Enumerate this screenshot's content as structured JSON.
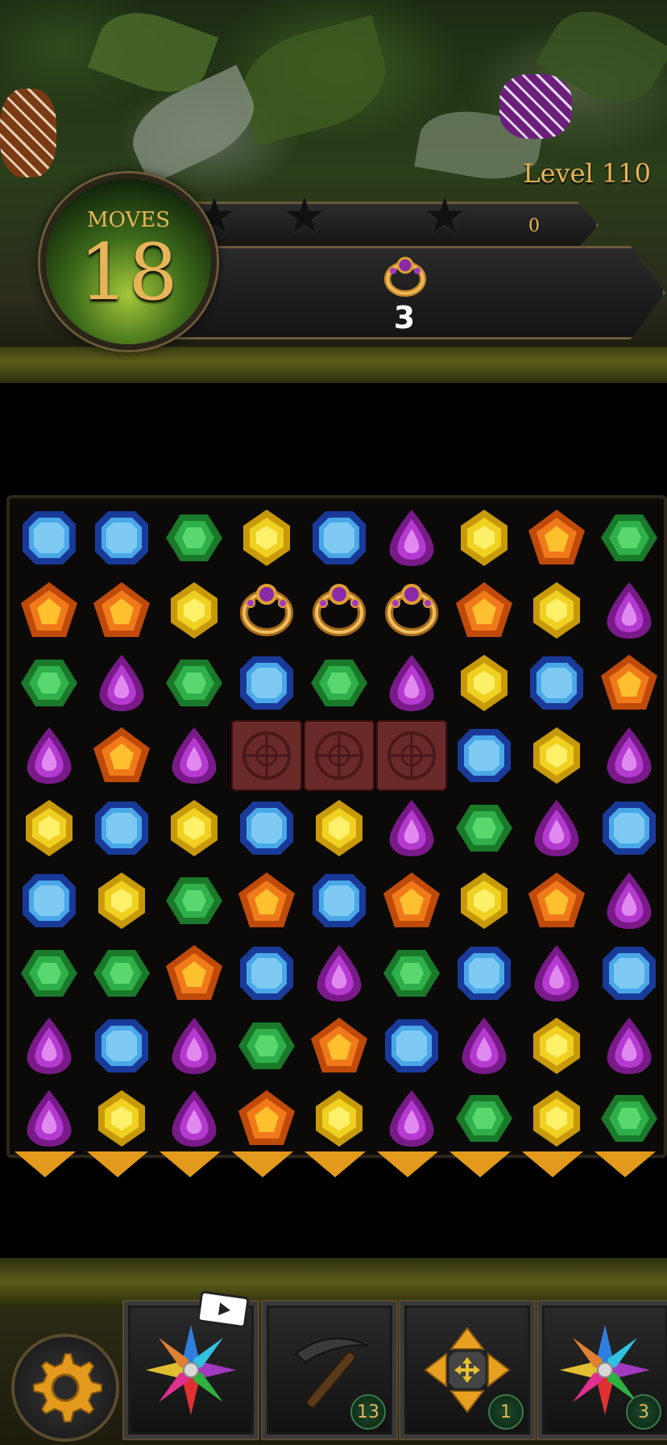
{
  "level": {
    "label": "Level 110"
  },
  "moves": {
    "label": "MOVES",
    "value": "18"
  },
  "score": {
    "value": "0"
  },
  "goal": {
    "item_icon": "ring-icon",
    "count": "3"
  },
  "booster_bar": {
    "settings_icon": "gear-icon",
    "items": [
      {
        "name": "multicolor-star-booster",
        "icon": "rainbow-star-icon",
        "has_video": true
      },
      {
        "name": "pickaxe-booster",
        "icon": "pickaxe-icon",
        "count": "13"
      },
      {
        "name": "swap-booster",
        "icon": "move-arrows-icon",
        "count": "1"
      },
      {
        "name": "star-gem-booster",
        "icon": "rainbow-star-icon",
        "count": "3"
      }
    ]
  },
  "board": {
    "cols": 9,
    "rows": [
      [
        "blue",
        "blue",
        "green",
        "yellow",
        "blue",
        "purple",
        "yellow",
        "orange",
        "green"
      ],
      [
        "orange",
        "orange",
        "yellow",
        "ring",
        "ring",
        "ring",
        "orange",
        "yellow",
        "purple"
      ],
      [
        "green",
        "purple",
        "green",
        "blue",
        "green",
        "purple",
        "yellow",
        "blue",
        "orange"
      ],
      [
        "purple",
        "orange",
        "purple",
        "block",
        "block",
        "block",
        "blue",
        "yellow",
        "purple"
      ],
      [
        "yellow",
        "blue",
        "yellow",
        "blue",
        "yellow",
        "purple",
        "green",
        "purple",
        "blue"
      ],
      [
        "blue",
        "yellow",
        "green",
        "orange",
        "blue",
        "orange",
        "yellow",
        "orange",
        "purple"
      ],
      [
        "green",
        "green",
        "orange",
        "blue",
        "purple",
        "green",
        "blue",
        "purple",
        "blue"
      ],
      [
        "purple",
        "blue",
        "purple",
        "green",
        "orange",
        "blue",
        "purple",
        "yellow",
        "purple"
      ],
      [
        "purple",
        "yellow",
        "purple",
        "orange",
        "yellow",
        "purple",
        "green",
        "yellow",
        "green"
      ]
    ]
  },
  "colors": {
    "accent": "#e8b45a",
    "arrow": "#e39a1c"
  }
}
